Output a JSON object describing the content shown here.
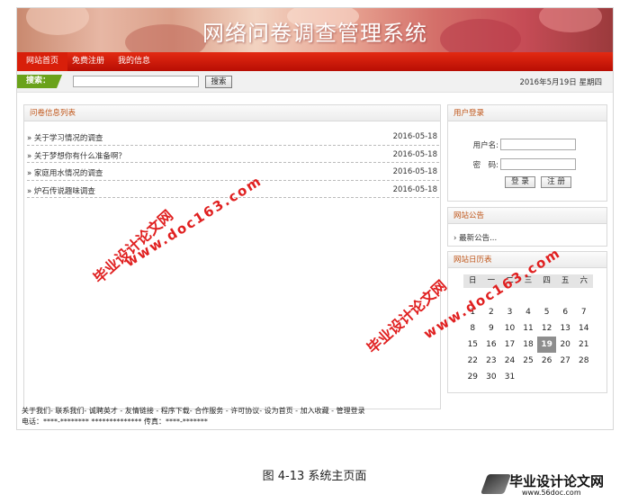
{
  "banner": {
    "title": "网络问卷调查管理系统"
  },
  "nav": {
    "items": [
      "网站首页",
      "免费注册",
      "我的信息"
    ]
  },
  "search": {
    "label": "搜索：",
    "value": "",
    "button": "搜索"
  },
  "header": {
    "date": "2016年5月19日 星期四"
  },
  "surveys": {
    "title": "问卷信息列表",
    "items": [
      {
        "title": "关于学习情况的调查",
        "date": "2016-05-18"
      },
      {
        "title": "关于梦想你有什么准备啊？",
        "date": "2016-05-18"
      },
      {
        "title": "家庭用水情况的调查",
        "date": "2016-05-18"
      },
      {
        "title": "炉石传说趣味调查",
        "date": "2016-05-18"
      }
    ]
  },
  "login": {
    "title": "用户登录",
    "username_label": "用户名:",
    "password_label": "密　码:",
    "login_button": "登 录",
    "register_button": "注 册"
  },
  "notice": {
    "title": "网站公告",
    "item": "最新公告..."
  },
  "calendar": {
    "title": "网站日历表",
    "weekdays": [
      "日",
      "一",
      "二",
      "三",
      "四",
      "五",
      "六"
    ],
    "weeks": [
      [
        "",
        "",
        "",
        "",
        "",
        "",
        ""
      ],
      [
        "1",
        "2",
        "3",
        "4",
        "5",
        "6",
        "7"
      ],
      [
        "8",
        "9",
        "10",
        "11",
        "12",
        "13",
        "14"
      ],
      [
        "15",
        "16",
        "17",
        "18",
        "19",
        "20",
        "21"
      ],
      [
        "22",
        "23",
        "24",
        "25",
        "26",
        "27",
        "28"
      ],
      [
        "29",
        "30",
        "31",
        "",
        "",
        "",
        ""
      ]
    ],
    "today": "19"
  },
  "footer": {
    "links": "关于我们- 联系我们- 诚聘英才 - 友情链接 - 程序下载- 合作服务 - 许可协议- 设为首页 - 加入收藏 - 管理登录",
    "contact": "电话：****-******** ************** 传真：****-*******"
  },
  "watermarks": {
    "cn": "毕业设计论文网",
    "url": "www.doc163.com"
  },
  "caption": "图 4-13 系统主页面",
  "logo": {
    "cn": "毕业设计论文网",
    "url": "www.56doc.com"
  },
  "colors": {
    "nav_red": "#d81f0a",
    "accent_orange": "#c0561a",
    "search_green": "#6aa21a",
    "watermark_red": "#e02020"
  }
}
